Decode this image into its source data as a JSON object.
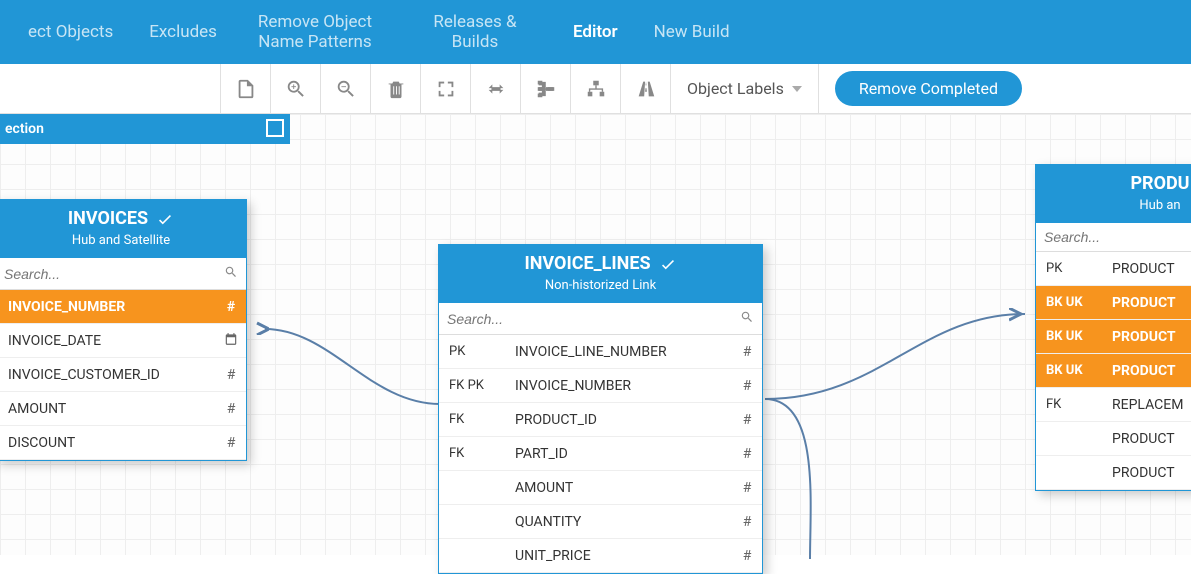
{
  "nav": {
    "items": [
      {
        "label": "ect Objects"
      },
      {
        "label": "Excludes"
      },
      {
        "label": "Remove Object Name Patterns"
      },
      {
        "label": "Releases & Builds"
      },
      {
        "label": "Editor",
        "active": true
      },
      {
        "label": "New Build"
      }
    ]
  },
  "toolbar": {
    "object_labels": "Object Labels",
    "remove_completed": "Remove Completed"
  },
  "section_label": "ection",
  "search_placeholder": "Search...",
  "entities": {
    "invoices": {
      "title": "INVOICES",
      "subtitle": "Hub and Satellite",
      "columns": [
        {
          "key": "",
          "name": "INVOICE_NUMBER",
          "type": "#",
          "hi": true
        },
        {
          "key": "",
          "name": "INVOICE_DATE",
          "type": "date"
        },
        {
          "key": "",
          "name": "INVOICE_CUSTOMER_ID",
          "type": "#"
        },
        {
          "key": "",
          "name": "AMOUNT",
          "type": "#"
        },
        {
          "key": "",
          "name": "DISCOUNT",
          "type": "#"
        }
      ]
    },
    "invoice_lines": {
      "title": "INVOICE_LINES",
      "subtitle": "Non-historized Link",
      "columns": [
        {
          "key": "PK",
          "name": "INVOICE_LINE_NUMBER",
          "type": "#"
        },
        {
          "key": "FK PK",
          "name": "INVOICE_NUMBER",
          "type": "#"
        },
        {
          "key": "FK",
          "name": "PRODUCT_ID",
          "type": "#"
        },
        {
          "key": "FK",
          "name": "PART_ID",
          "type": "#"
        },
        {
          "key": "",
          "name": "AMOUNT",
          "type": "#"
        },
        {
          "key": "",
          "name": "QUANTITY",
          "type": "#"
        },
        {
          "key": "",
          "name": "UNIT_PRICE",
          "type": "#"
        }
      ]
    },
    "products": {
      "title": "PRODU",
      "subtitle": "Hub an",
      "columns": [
        {
          "key": "PK",
          "name": "PRODUCT",
          "type": ""
        },
        {
          "key": "BK  UK",
          "name": "PRODUCT",
          "type": "",
          "hi": true
        },
        {
          "key": "BK  UK",
          "name": "PRODUCT",
          "type": "",
          "hi": true
        },
        {
          "key": "BK  UK",
          "name": "PRODUCT",
          "type": "",
          "hi": true
        },
        {
          "key": "FK",
          "name": "REPLACEM",
          "type": ""
        },
        {
          "key": "",
          "name": "PRODUCT",
          "type": ""
        },
        {
          "key": "",
          "name": "PRODUCT",
          "type": ""
        }
      ]
    }
  }
}
